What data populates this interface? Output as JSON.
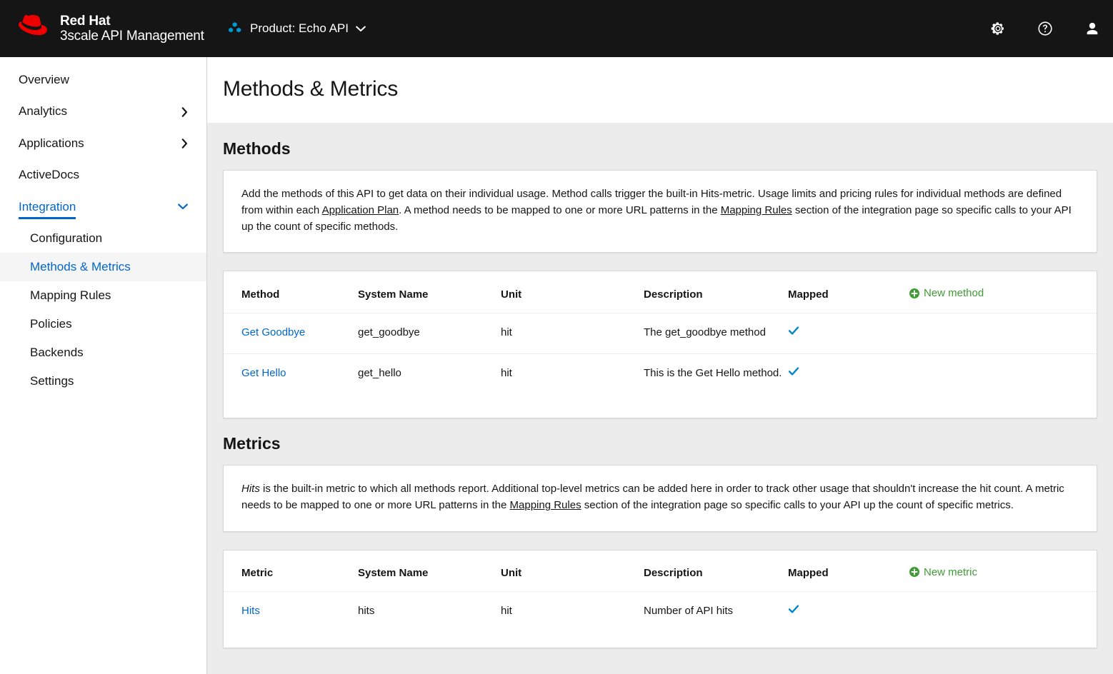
{
  "masthead": {
    "brand_line1": "Red Hat",
    "brand_line2": "3scale API Management",
    "logo_icon": "redhat-logo",
    "product_icon": "cubes-icon",
    "product_label": "Product: Echo API",
    "product_caret_icon": "caret-down-icon",
    "settings_icon": "gear-icon",
    "help_icon": "help-circle-icon",
    "user_icon": "user-icon",
    "background": "#151515"
  },
  "sidebar": {
    "items": [
      {
        "label": "Overview",
        "icon": "",
        "expandable": false,
        "state": "default"
      },
      {
        "label": "Analytics",
        "icon": "chevron-right-icon",
        "expandable": true,
        "state": "default"
      },
      {
        "label": "Applications",
        "icon": "chevron-right-icon",
        "expandable": true,
        "state": "default"
      },
      {
        "label": "ActiveDocs",
        "icon": "",
        "expandable": false,
        "state": "default"
      },
      {
        "label": "Integration",
        "icon": "chevron-down-icon",
        "expandable": true,
        "state": "expanded"
      }
    ],
    "subitems": [
      {
        "label": "Configuration",
        "active": false
      },
      {
        "label": "Methods & Metrics",
        "active": true
      },
      {
        "label": "Mapping Rules",
        "active": false
      },
      {
        "label": "Policies",
        "active": false
      },
      {
        "label": "Backends",
        "active": false
      },
      {
        "label": "Settings",
        "active": false
      }
    ],
    "accent_color": "#0066cc"
  },
  "page": {
    "title": "Methods & Metrics"
  },
  "methods": {
    "section_title": "Methods",
    "description_prefix": "Add the methods of this API to get data on their individual usage. Method calls trigger the built-in Hits-metric. Usage limits and pricing rules for individual methods are defined from within each ",
    "link1": "Application Plan",
    "description_middle": ". A method needs to be mapped to one or more URL patterns in the ",
    "link2": "Mapping Rules",
    "description_suffix": " section of the integration page so specific calls to your API up the count of specific methods.",
    "columns": [
      "Method",
      "System Name",
      "Unit",
      "Description",
      "Mapped"
    ],
    "new_label": "New method",
    "new_icon": "plus-circle-icon",
    "rows": [
      {
        "name": "Get Goodbye",
        "system_name": "get_goodbye",
        "unit": "hit",
        "description": "The get_goodbye method",
        "mapped": true,
        "mapped_icon": "check-icon"
      },
      {
        "name": "Get Hello",
        "system_name": "get_hello",
        "unit": "hit",
        "description": "This is the Get Hello method.",
        "mapped": true,
        "mapped_icon": "check-icon"
      }
    ]
  },
  "metrics": {
    "section_title": "Metrics",
    "description_em": "Hits",
    "description_prefix": " is the built-in metric to which all methods report. Additional top-level metrics can be added here in order to track other usage that shouldn't increase the hit count. A metric needs to be mapped to one or more URL patterns in the ",
    "link1": "Mapping Rules",
    "description_suffix": " section of the integration page so specific calls to your API up the count of specific metrics.",
    "columns": [
      "Metric",
      "System Name",
      "Unit",
      "Description",
      "Mapped"
    ],
    "new_label": "New metric",
    "new_icon": "plus-circle-icon",
    "rows": [
      {
        "name": "Hits",
        "system_name": "hits",
        "unit": "hit",
        "description": "Number of API hits",
        "mapped": true,
        "mapped_icon": "check-icon"
      }
    ]
  },
  "colors": {
    "accent_blue": "#0066cc",
    "link_blue": "#0088ce",
    "green": "#3f9c35",
    "red": "#ee0000",
    "masthead_bg": "#151515",
    "page_bg": "#ececec"
  }
}
